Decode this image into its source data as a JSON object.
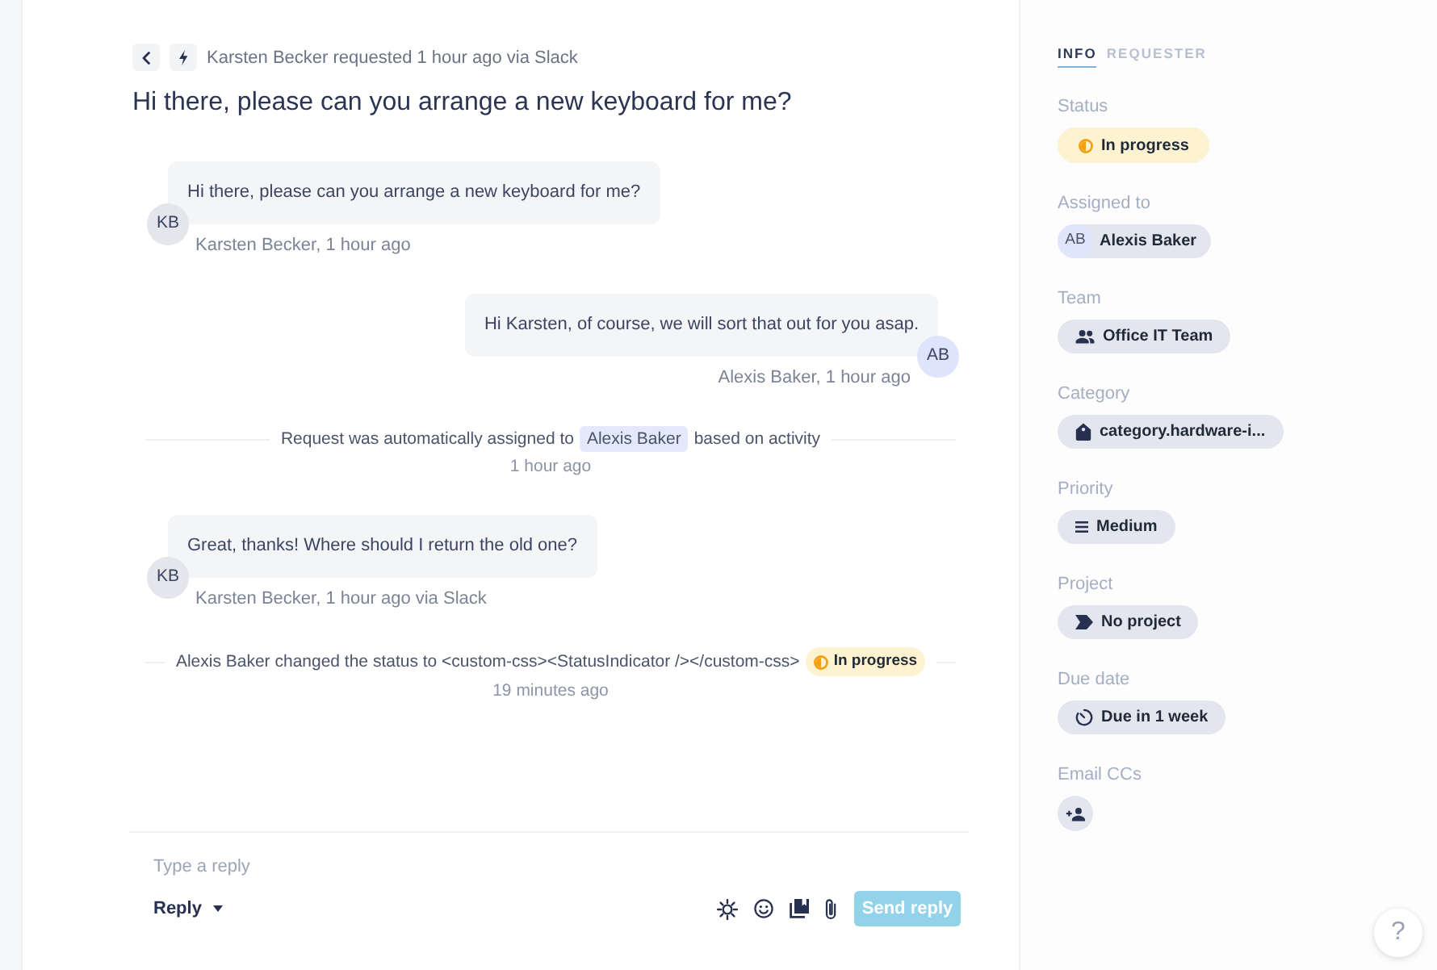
{
  "header": {
    "source": "Karsten Becker requested 1 hour ago via Slack",
    "title": "Hi there, please can you arrange a new keyboard for me?"
  },
  "timeline": [
    {
      "kind": "incoming",
      "avatar": "KB",
      "text": "Hi there, please can you arrange a new keyboard for me?",
      "meta": "Karsten Becker, 1 hour ago"
    },
    {
      "kind": "outgoing",
      "avatar": "AB",
      "text": "Hi Karsten, of course, we will sort that out for you asap.",
      "meta": "Alexis Baker, 1 hour ago"
    },
    {
      "kind": "event",
      "segments": [
        {
          "kind": "text",
          "text": "Request was automatically assigned to"
        },
        {
          "kind": "person",
          "text": "Alexis Baker"
        },
        {
          "kind": "text",
          "text": "based on activity"
        }
      ],
      "time": "1 hour ago"
    },
    {
      "kind": "incoming",
      "avatar": "KB",
      "text": "Great, thanks! Where should I return the old one?",
      "meta": "Karsten Becker, 1 hour ago via Slack"
    },
    {
      "kind": "event",
      "segments": [
        {
          "kind": "text",
          "text": "Alexis Baker changed the status to <custom-css><StatusIndicator /></custom-css>"
        },
        {
          "kind": "status",
          "text": "In progress"
        }
      ],
      "time": "19 minutes ago"
    }
  ],
  "composer": {
    "placeholder": "Type a reply",
    "mode": "Reply",
    "send_button": {
      "label": "Send reply",
      "disabled": true
    }
  },
  "sidebar": {
    "tabs": [
      {
        "label": "INFO",
        "selected": true
      },
      {
        "label": "REQUESTER",
        "selected": false
      }
    ],
    "fields": [
      {
        "kind": "status",
        "label": "Status",
        "value": "In progress"
      },
      {
        "kind": "person",
        "label": "Assigned to",
        "avatar": "AB",
        "value": "Alexis Baker"
      },
      {
        "kind": "team",
        "label": "Team",
        "value": "Office IT Team"
      },
      {
        "kind": "category",
        "label": "Category",
        "value": "category.hardware-i..."
      },
      {
        "kind": "priority",
        "label": "Priority",
        "value": "Medium"
      },
      {
        "kind": "project",
        "label": "Project",
        "value": "No project"
      },
      {
        "kind": "due",
        "label": "Due date",
        "value": "Due in 1 week"
      },
      {
        "kind": "add_cc",
        "label": "Email CCs"
      }
    ]
  },
  "help_button": "?"
}
